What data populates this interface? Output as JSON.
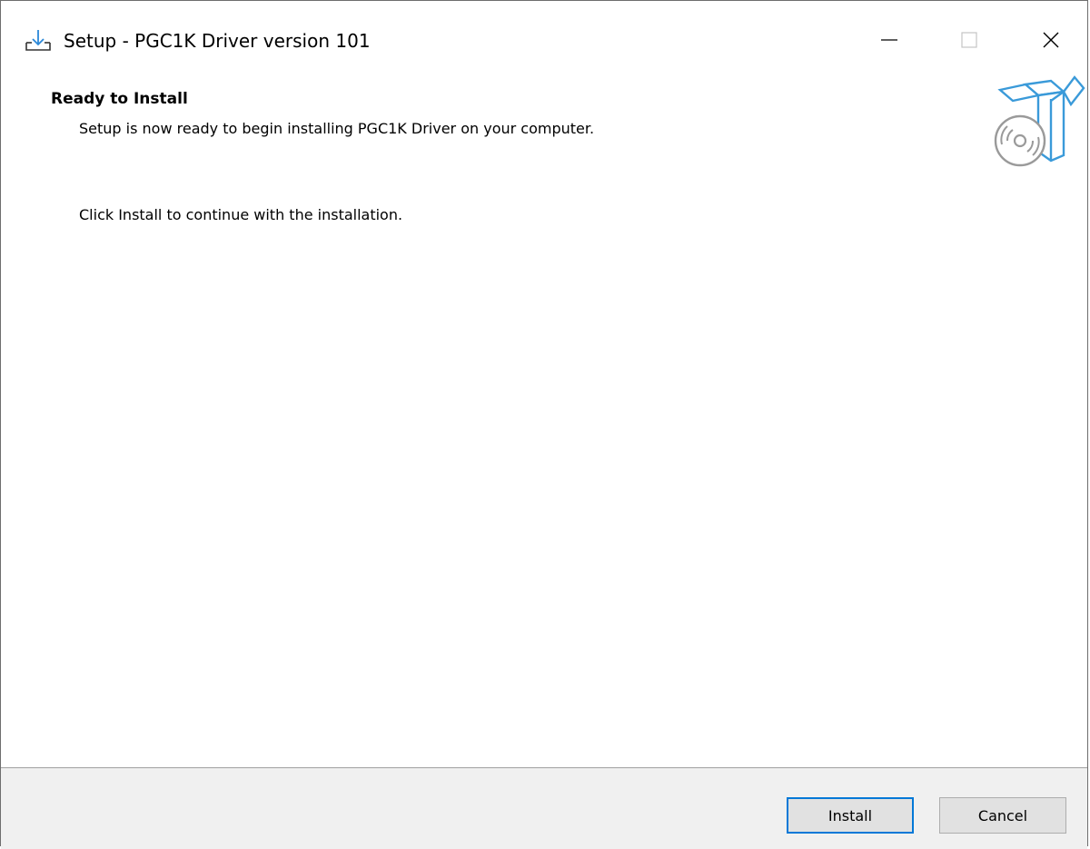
{
  "window": {
    "title": "Setup - PGC1K Driver version 101",
    "icon": "setup-download-icon",
    "controls": {
      "minimize": "minimize-icon",
      "maximize": "maximize-icon",
      "close": "close-icon"
    }
  },
  "header": {
    "heading": "Ready to Install",
    "subheading": "Setup is now ready to begin installing PGC1K Driver on your computer.",
    "graphic": "software-box-disc-icon"
  },
  "main": {
    "instruction": "Click Install to continue with the installation."
  },
  "footer": {
    "install_label": "Install",
    "cancel_label": "Cancel"
  },
  "colors": {
    "accent": "#0078d7",
    "footer_bg": "#f0f0f0",
    "button_bg": "#e1e1e1",
    "graphic_blue": "#3a9ad9"
  }
}
